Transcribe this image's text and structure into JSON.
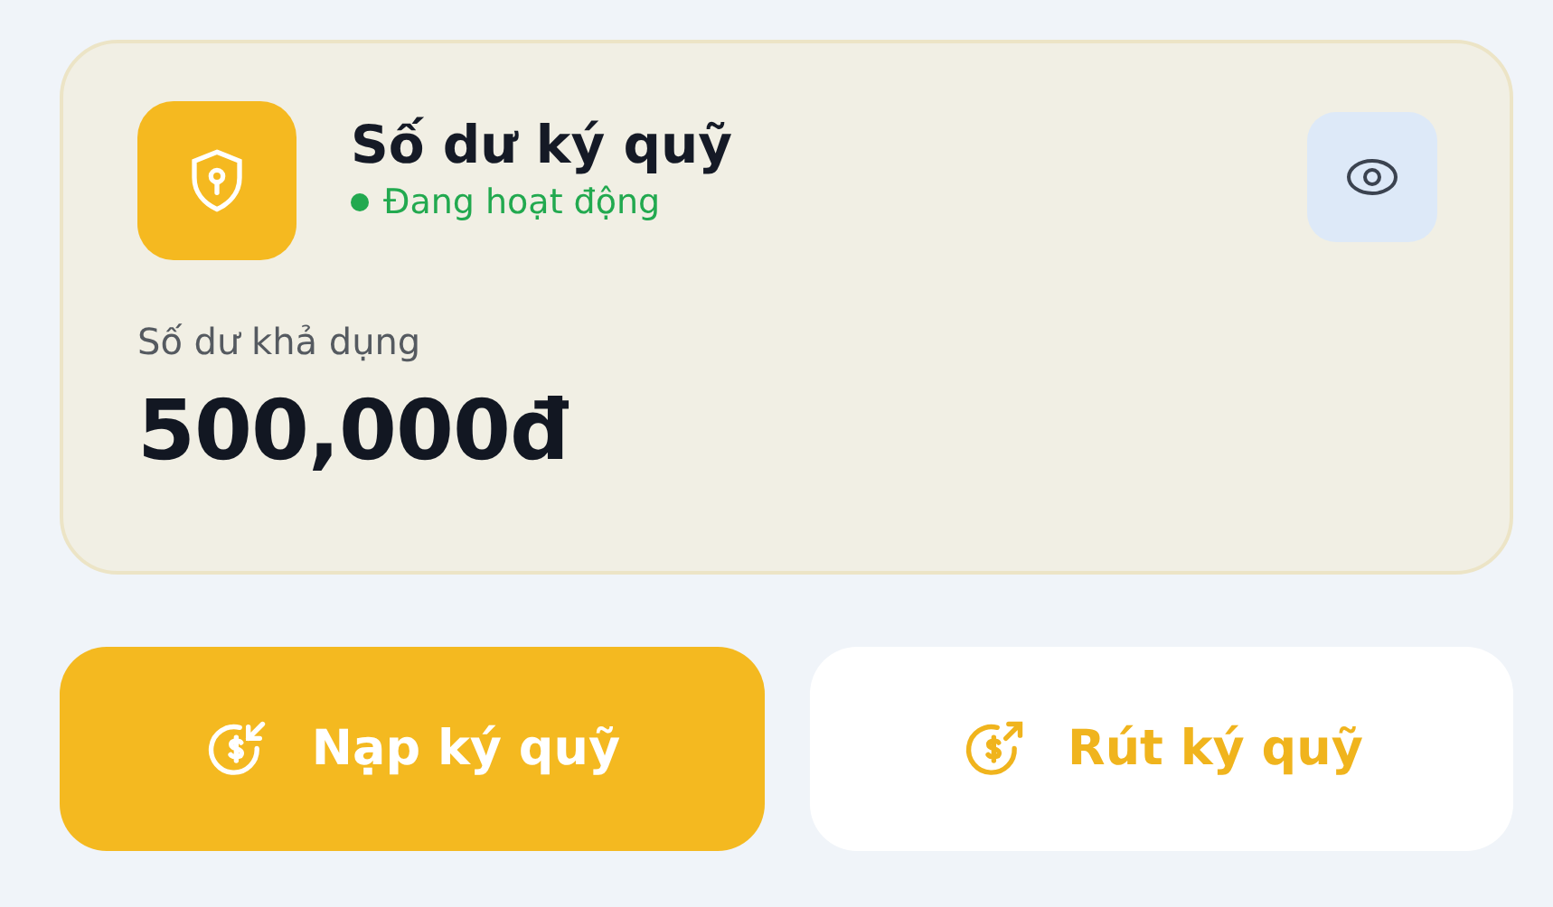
{
  "card": {
    "title": "Số dư ký quỹ",
    "status": {
      "label": "Đang hoạt động",
      "color": "#22a94f"
    },
    "balance_label": "Số dư khả dụng",
    "balance": "500,000đ"
  },
  "actions": [
    {
      "kind": "deposit",
      "label": "Nạp ký quỹ"
    },
    {
      "kind": "withdraw",
      "label": "Rút ký quỹ"
    }
  ]
}
